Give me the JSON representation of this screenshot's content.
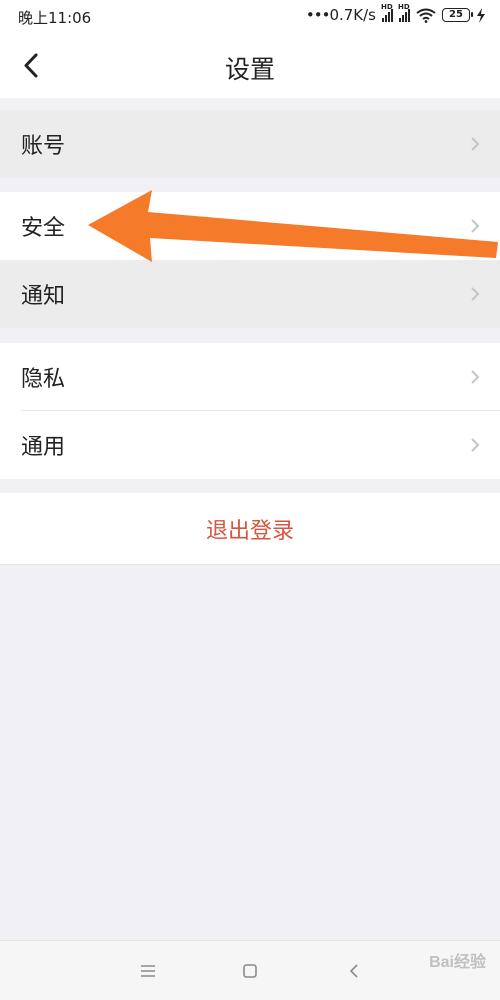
{
  "status_bar": {
    "time": "晚上11:06",
    "network_speed": "0.7K/s",
    "signal_1_label": "HD",
    "signal_2_label": "HD",
    "battery": "25",
    "icons": [
      "signal-icon",
      "signal-icon",
      "wifi-icon",
      "battery-icon",
      "charging-icon"
    ]
  },
  "header": {
    "back_icon": "chevron-left-icon",
    "title": "设置"
  },
  "settings": {
    "group1": [
      {
        "label": "账号"
      }
    ],
    "group2": [
      {
        "label": "安全"
      },
      {
        "label": "通知"
      }
    ],
    "group3": [
      {
        "label": "隐私"
      },
      {
        "label": "通用"
      }
    ],
    "logout_label": "退出登录"
  },
  "annotation": {
    "color": "#f57a2a",
    "icon": "arrow-left-annotation"
  },
  "nav_bar": {
    "icons": [
      "menu-icon",
      "home-square-icon",
      "back-triangle-icon"
    ]
  },
  "watermark": "Bai经验",
  "colors": {
    "background": "#f1f1f5",
    "logout_text": "#d9543f",
    "highlight_row": "#ececec"
  }
}
